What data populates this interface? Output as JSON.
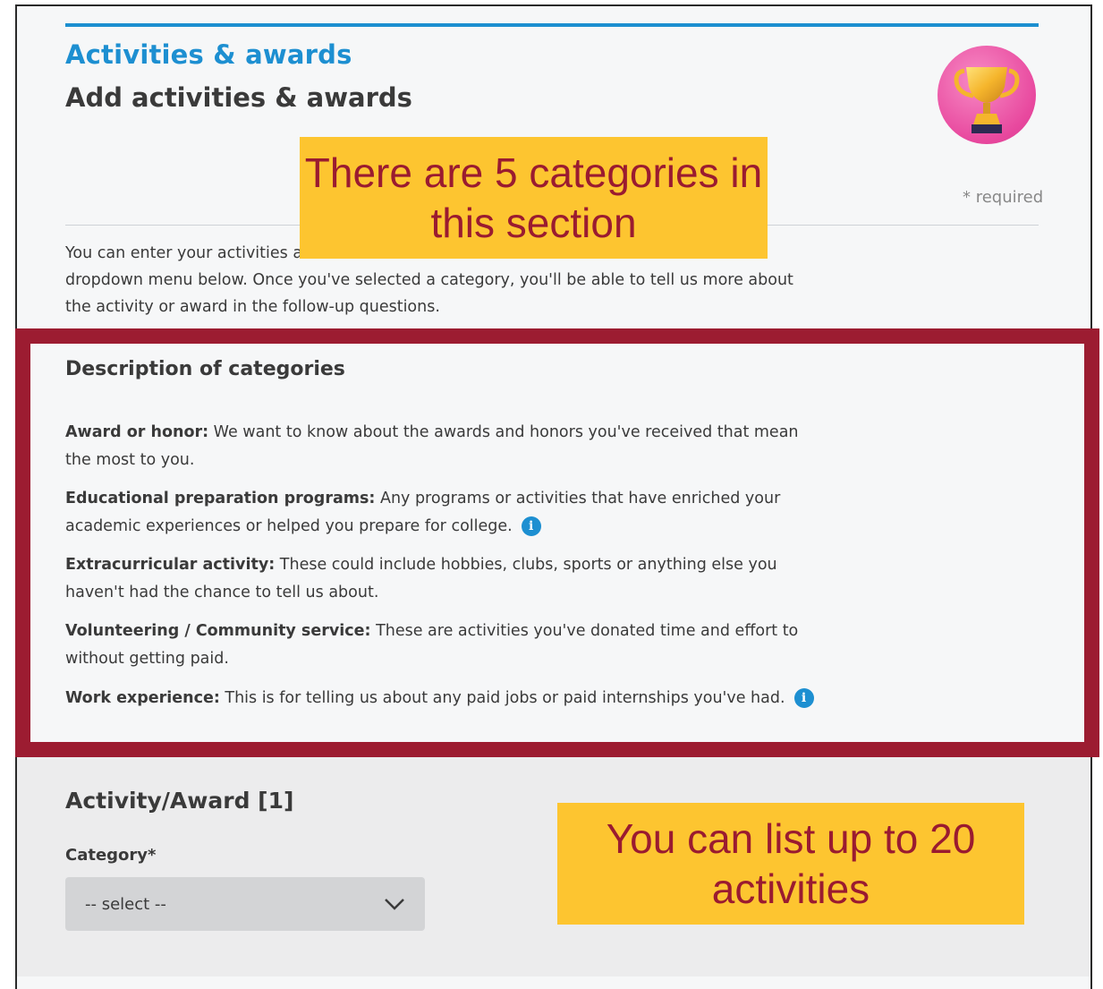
{
  "header": {
    "kicker": "Activities & awards",
    "title": "Add activities & awards",
    "required_note": "* required",
    "badge_icon": "trophy-icon"
  },
  "intro": {
    "text": "You can enter your activities a",
    "text_cont": "dropdown menu below. Once you've selected a category, you'll be able to tell us more about the activity or award in the follow-up questions."
  },
  "callouts": {
    "top": "There are 5 categories in this section",
    "bottom": "You can list up to 20 activities"
  },
  "description": {
    "title": "Description of categories",
    "categories": [
      {
        "name": "Award or honor:",
        "text": " We want to know about the awards and honors you've received that mean the most to you.",
        "info": false
      },
      {
        "name": "Educational preparation programs:",
        "text": " Any programs or activities that have enriched your academic experiences or helped you prepare for college.",
        "info": true
      },
      {
        "name": "Extracurricular activity:",
        "text": " These could include hobbies, clubs, sports or anything else you haven't had the chance to tell us about.",
        "info": false
      },
      {
        "name": "Volunteering / Community service:",
        "text": " These are activities you've donated time and effort to without getting paid.",
        "info": false
      },
      {
        "name": "Work experience:",
        "text": " This is for telling us about any paid jobs or paid internships you've had.",
        "info": true
      }
    ]
  },
  "activity": {
    "title": "Activity/Award [1]",
    "category_label": "Category*",
    "select_value": "-- select --"
  },
  "colors": {
    "accent": "#1d8fd1",
    "callout_bg": "#fdc530",
    "callout_text": "#9a1b30",
    "highlight_border": "#9c1c31"
  }
}
